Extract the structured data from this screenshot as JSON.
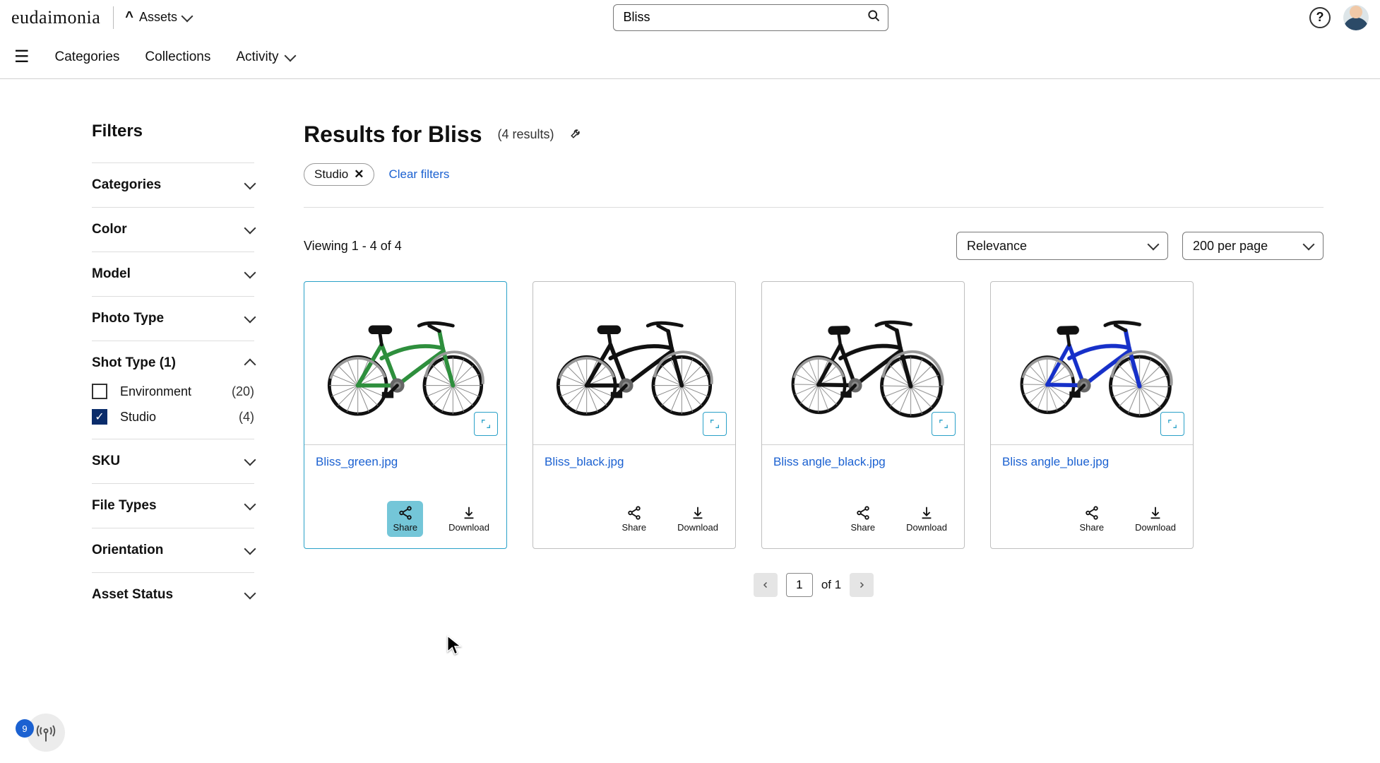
{
  "header": {
    "logo_text": "eudaimonia",
    "assets_label": "Assets",
    "search_value": "Bliss",
    "help_tooltip": "Help"
  },
  "nav": {
    "categories": "Categories",
    "collections": "Collections",
    "activity": "Activity"
  },
  "filters": {
    "title": "Filters",
    "groups": {
      "categories": "Categories",
      "color": "Color",
      "model": "Model",
      "photo_type": "Photo Type",
      "shot_type": "Shot Type (1)",
      "sku": "SKU",
      "file_types": "File Types",
      "orientation": "Orientation",
      "asset_status": "Asset Status"
    },
    "shot_type_options": [
      {
        "label": "Environment",
        "count": "(20)",
        "checked": false
      },
      {
        "label": "Studio",
        "count": "(4)",
        "checked": true
      }
    ]
  },
  "results": {
    "title": "Results for Bliss",
    "count_label": "(4 results)",
    "chip_label": "Studio",
    "clear_label": "Clear filters",
    "viewing": "Viewing 1 - 4 of 4",
    "sort_value": "Relevance",
    "perpage_value": "200 per page"
  },
  "cards": [
    {
      "file": "Bliss_green.jpg",
      "color": "#2e8f3d",
      "angle": false,
      "share": "Share",
      "download": "Download",
      "share_hl": true
    },
    {
      "file": "Bliss_black.jpg",
      "color": "#111111",
      "angle": false,
      "share": "Share",
      "download": "Download",
      "share_hl": false
    },
    {
      "file": "Bliss angle_black.jpg",
      "color": "#111111",
      "angle": true,
      "share": "Share",
      "download": "Download",
      "share_hl": false
    },
    {
      "file": "Bliss angle_blue.jpg",
      "color": "#1630c9",
      "angle": true,
      "share": "Share",
      "download": "Download",
      "share_hl": false
    }
  ],
  "pagination": {
    "page": "1",
    "of_label": "of 1"
  },
  "corner_badge": "9"
}
